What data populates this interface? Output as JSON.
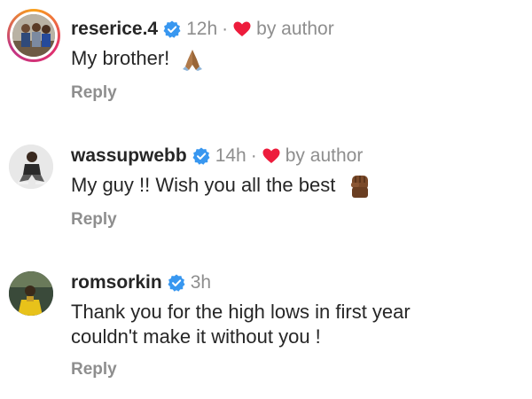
{
  "comments": [
    {
      "username": "reserice.4",
      "time": "12h",
      "separator": "·",
      "liked_by": "by author",
      "text": "My brother!",
      "emoji": "folded-hands",
      "reply_label": "Reply"
    },
    {
      "username": "wassupwebb",
      "time": "14h",
      "separator": "·",
      "liked_by": "by author",
      "text": "My guy !! Wish you all the best",
      "emoji": "raised-fist",
      "reply_label": "Reply"
    },
    {
      "username": "romsorkin",
      "time": "3h",
      "text_line1": "Thank you for the high lows in first year",
      "text_line2": "couldn't make it without you !",
      "reply_label": "Reply"
    }
  ],
  "colors": {
    "verified_blue": "#3897f0",
    "heart_red": "#ed1c3c",
    "meta_gray": "#8e8e8e",
    "text_dark": "#262626"
  }
}
